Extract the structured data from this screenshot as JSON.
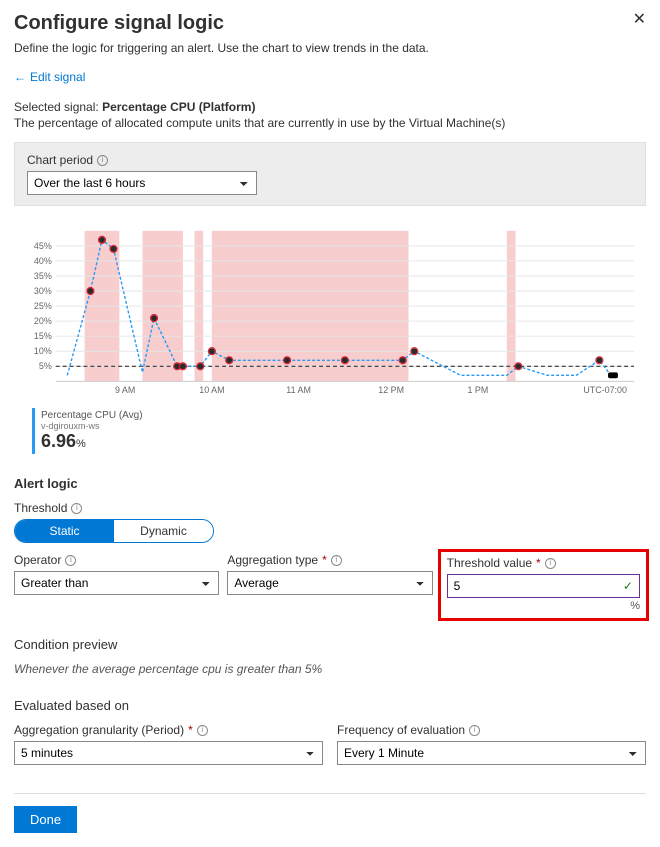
{
  "header": {
    "title": "Configure signal logic",
    "subtitle": "Define the logic for triggering an alert. Use the chart to view trends in the data.",
    "edit_signal": "Edit signal"
  },
  "signal": {
    "label_prefix": "Selected signal:",
    "label_value": "Percentage CPU (Platform)",
    "description": "The percentage of allocated compute units that are currently in use by the Virtual Machine(s)"
  },
  "chart_period": {
    "label": "Chart period",
    "value": "Over the last 6 hours"
  },
  "chart_data": {
    "type": "line",
    "title": "",
    "xlabel": "",
    "ylabel": "",
    "ylim": [
      0,
      50
    ],
    "y_ticks": [
      "5%",
      "10%",
      "15%",
      "20%",
      "25%",
      "30%",
      "35%",
      "40%",
      "45%"
    ],
    "x_ticks": [
      "9 AM",
      "10 AM",
      "11 AM",
      "12 PM",
      "1 PM",
      "UTC-07:00"
    ],
    "threshold": 5,
    "shaded_bands_x": [
      [
        0.05,
        0.11
      ],
      [
        0.15,
        0.22
      ],
      [
        0.24,
        0.255
      ],
      [
        0.27,
        0.61
      ],
      [
        0.78,
        0.795
      ]
    ],
    "series": [
      {
        "name": "Percentage CPU (Avg)",
        "source": "v-dgirouxm-ws",
        "current": "6.96",
        "unit": "%",
        "points_x": [
          0.02,
          0.06,
          0.08,
          0.1,
          0.15,
          0.17,
          0.21,
          0.22,
          0.25,
          0.27,
          0.3,
          0.4,
          0.5,
          0.6,
          0.62,
          0.7,
          0.78,
          0.8,
          0.85,
          0.9,
          0.94,
          0.96
        ],
        "points_y": [
          2,
          30,
          47,
          44,
          3,
          21,
          5,
          5,
          5,
          10,
          7,
          7,
          7,
          7,
          10,
          2,
          2,
          5,
          2,
          2,
          7,
          2
        ]
      }
    ]
  },
  "alert_logic": {
    "section_title": "Alert logic",
    "threshold_label": "Threshold",
    "toggle": {
      "static": "Static",
      "dynamic": "Dynamic",
      "active": "static"
    },
    "operator": {
      "label": "Operator",
      "value": "Greater than"
    },
    "aggregation_type": {
      "label": "Aggregation type",
      "value": "Average"
    },
    "threshold_value": {
      "label": "Threshold value",
      "value": "5",
      "unit": "%"
    }
  },
  "condition_preview": {
    "title": "Condition preview",
    "text": "Whenever the average percentage cpu is greater than 5%"
  },
  "evaluated": {
    "title": "Evaluated based on",
    "granularity": {
      "label": "Aggregation granularity (Period)",
      "value": "5 minutes"
    },
    "frequency": {
      "label": "Frequency of evaluation",
      "value": "Every 1 Minute"
    }
  },
  "buttons": {
    "done": "Done"
  },
  "colors": {
    "accent": "#0078d4",
    "highlight_band": "#f6c4c6",
    "threshold_line": "#333"
  }
}
